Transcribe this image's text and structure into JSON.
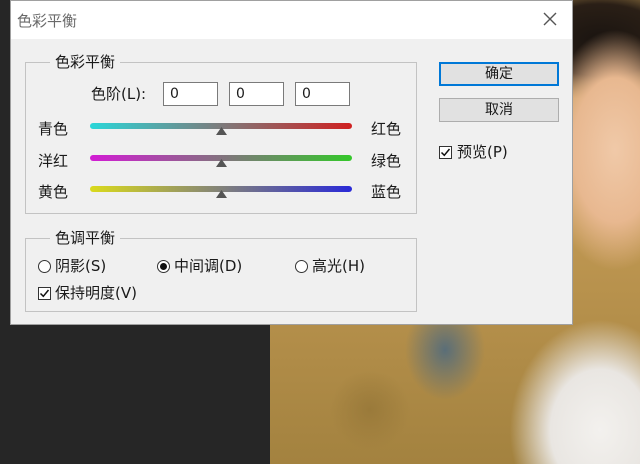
{
  "dialog": {
    "title": "色彩平衡",
    "close_icon": "close-icon"
  },
  "color_balance": {
    "group_title": "色彩平衡",
    "levels_label": "色阶(L):",
    "levels": [
      "0",
      "0",
      "0"
    ],
    "sliders": [
      {
        "left": "青色",
        "right": "红色",
        "value": 0
      },
      {
        "left": "洋红",
        "right": "绿色",
        "value": 0
      },
      {
        "left": "黄色",
        "right": "蓝色",
        "value": 0
      }
    ]
  },
  "tone_balance": {
    "group_title": "色调平衡",
    "options": [
      "阴影(S)",
      "中间调(D)",
      "高光(H)"
    ],
    "selected": "中间调(D)",
    "preserve_luminosity": {
      "label": "保持明度(V)",
      "checked": true
    }
  },
  "buttons": {
    "ok": "确定",
    "cancel": "取消"
  },
  "preview": {
    "label": "预览(P)",
    "checked": true
  },
  "colors": {
    "dialog_bg": "#f0f0f0",
    "default_button_border": "#0078d7"
  }
}
